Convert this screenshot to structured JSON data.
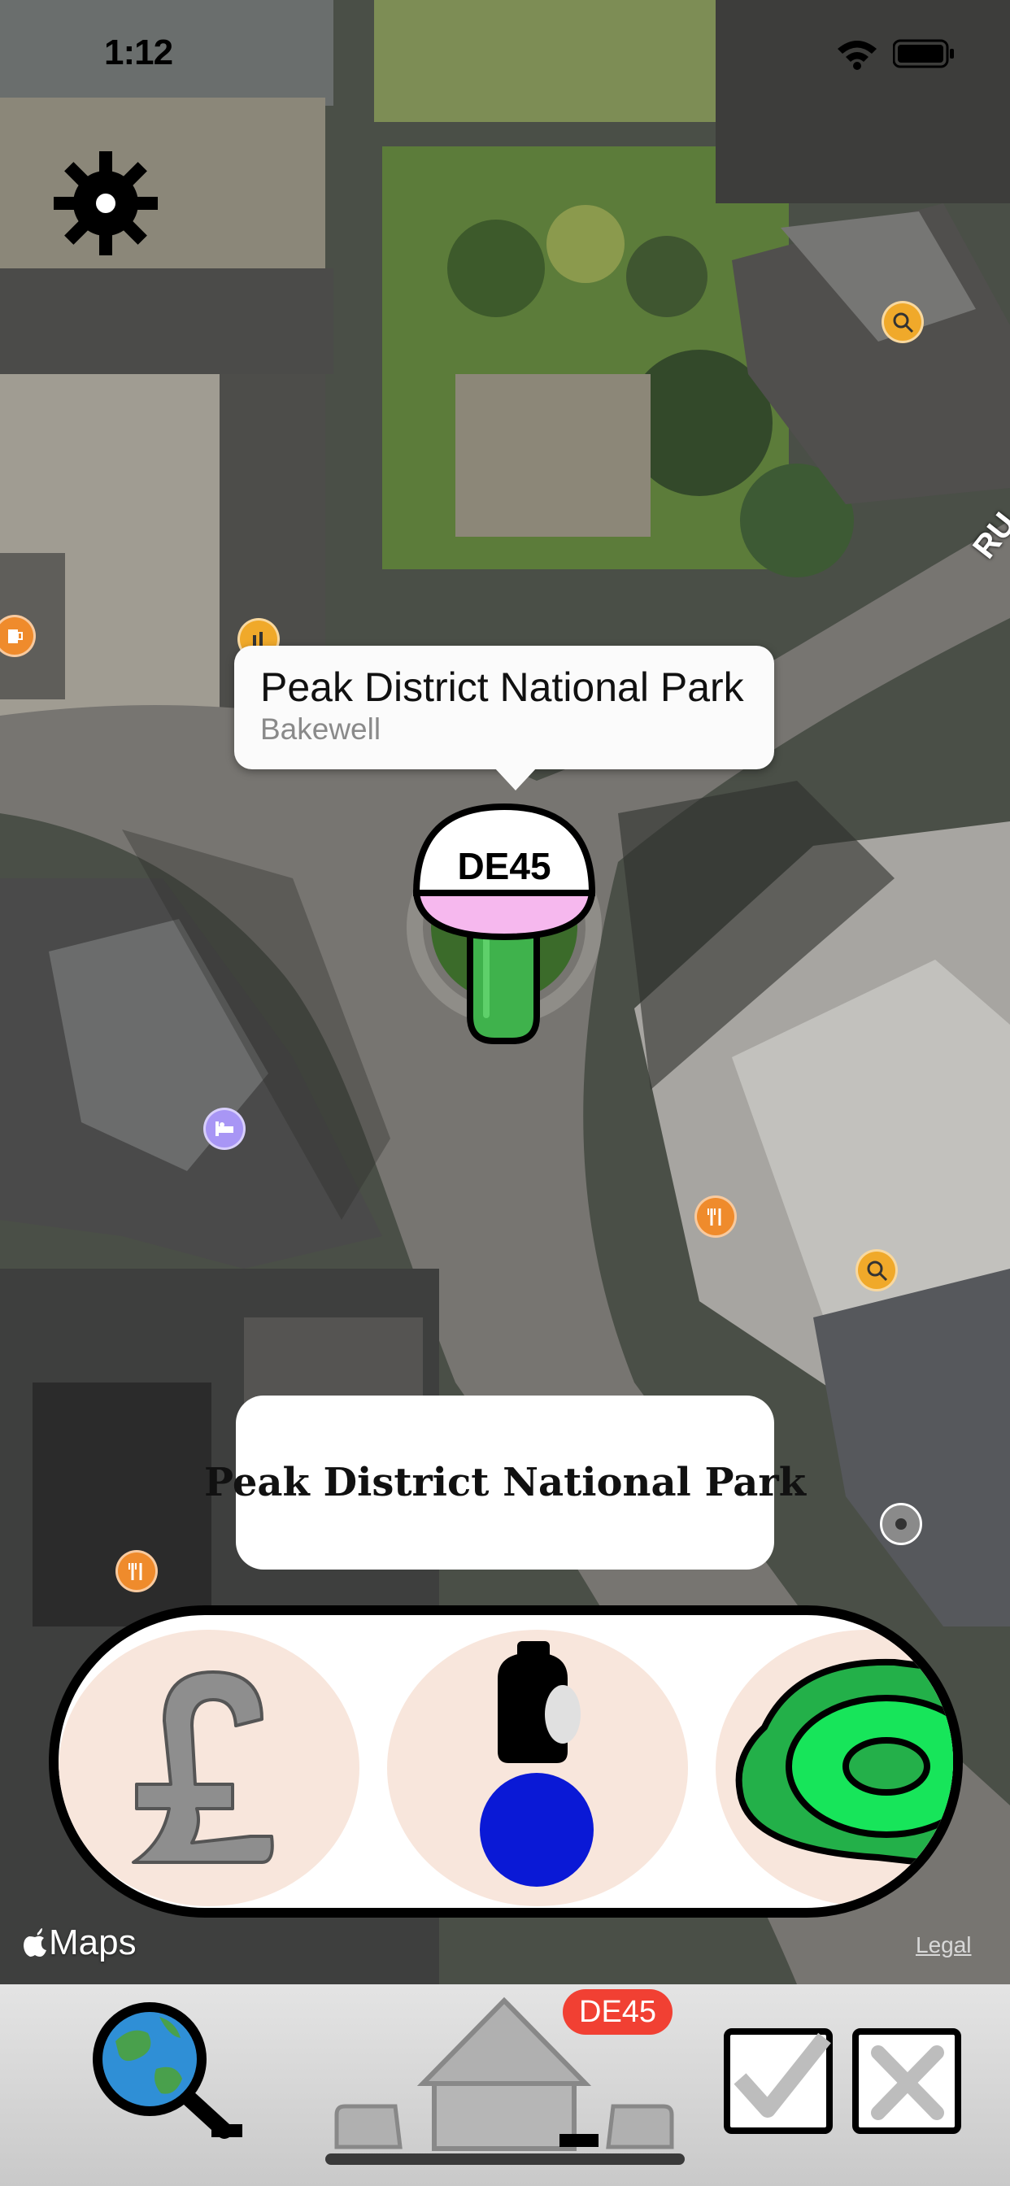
{
  "status_bar": {
    "time": "1:12"
  },
  "map": {
    "callout": {
      "title": "Peak District National Park",
      "subtitle": "Bakewell"
    },
    "road_pin": {
      "label": "DE45"
    },
    "road_label_fragment": "RU",
    "attribution": {
      "brand": "Maps",
      "legal": "Legal"
    }
  },
  "name_card": {
    "title": "Peak District National Park"
  },
  "actions": [
    {
      "name": "price-button",
      "icon": "pound-icon"
    },
    {
      "name": "toilet-button",
      "icon": "toilet-icon"
    },
    {
      "name": "track-button",
      "icon": "green-ring-icon"
    }
  ],
  "bottom_bar": {
    "home_badge": "DE45",
    "icons": [
      "globe-search-icon",
      "house-icon",
      "checkmark-icon",
      "close-icon"
    ]
  },
  "colors": {
    "callout_bg": "#fbfbfb",
    "badge": "#f14033",
    "action_bg": "#f8e6dc",
    "pin_green": "#3fb24c",
    "pin_pink": "#f6b8ee"
  }
}
